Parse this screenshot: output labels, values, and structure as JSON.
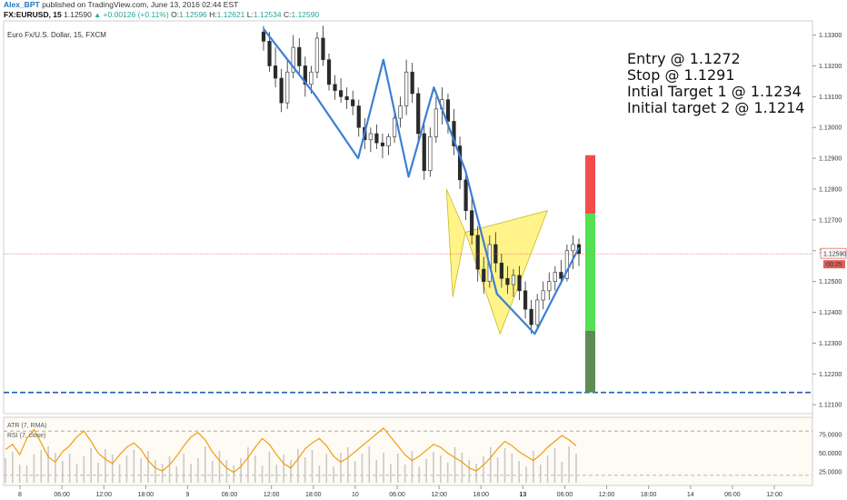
{
  "header": {
    "username": "Alex_BPT",
    "published": "published on TradingView.com, June 13, 2016 02:44 EST",
    "symbol": "FX:EURUSD, 15",
    "last": "1.12590",
    "change": "+0.00126 (+0.11%)",
    "open_label": "O:",
    "open": "1.12596",
    "high_label": "H:",
    "high": "1.12621",
    "low_label": "L:",
    "low": "1.12534",
    "close_label": "C:",
    "close": "1.12590"
  },
  "chart_data": {
    "type": "candlestick",
    "title": "Euro Fx/U.S. Dollar, 15, FXCM",
    "y_ticks": [
      "1.13300",
      "1.13200",
      "1.13100",
      "1.13000",
      "1.12900",
      "1.12800",
      "1.12700",
      "1.12600",
      "1.12500",
      "1.12400",
      "1.12300",
      "1.12200",
      "1.12100"
    ],
    "ylim": [
      1.1208,
      1.1334
    ],
    "x_ticks": [
      "8",
      "06:00",
      "12:00",
      "18:00",
      "9",
      "06:00",
      "12:00",
      "18:00",
      "10",
      "06:00",
      "12:00",
      "18:00",
      "13",
      "06:00",
      "12:00",
      "18:00",
      "14",
      "06:00",
      "12:00"
    ],
    "last_price_tag": "1.12590",
    "timer_tag": "00:25",
    "last_price": 1.1259,
    "zigzag": [
      [
        0.0,
        1.1332
      ],
      [
        0.16,
        1.1311
      ],
      [
        0.3,
        1.129
      ],
      [
        0.38,
        1.1322
      ],
      [
        0.46,
        1.1284
      ],
      [
        0.54,
        1.1313
      ],
      [
        0.64,
        1.1286
      ],
      [
        0.74,
        1.1246
      ],
      [
        0.86,
        1.1233
      ],
      [
        1.0,
        1.1261
      ]
    ],
    "abcd_lines": [
      [
        0.64,
        1.1286
      ],
      [
        0.74,
        1.1246
      ],
      [
        0.86,
        1.1233
      ],
      [
        0.96,
        1.1273
      ]
    ],
    "harmonic_pattern": {
      "X": [
        0.58,
        1.128
      ],
      "A": [
        0.6,
        1.1245
      ],
      "B": [
        0.64,
        1.1266
      ],
      "C": [
        0.75,
        1.1233
      ],
      "D": [
        0.9,
        1.1273
      ]
    },
    "candles": [
      [
        1.1331,
        1.1333,
        1.1325,
        1.1328
      ],
      [
        1.1328,
        1.1331,
        1.1318,
        1.132
      ],
      [
        1.132,
        1.1326,
        1.1313,
        1.1316
      ],
      [
        1.1316,
        1.1319,
        1.1305,
        1.1308
      ],
      [
        1.1308,
        1.1322,
        1.1306,
        1.1318
      ],
      [
        1.1318,
        1.133,
        1.1316,
        1.1326
      ],
      [
        1.1326,
        1.1329,
        1.1317,
        1.132
      ],
      [
        1.132,
        1.1323,
        1.131,
        1.1314
      ],
      [
        1.1314,
        1.132,
        1.1311,
        1.1318
      ],
      [
        1.1318,
        1.1331,
        1.1316,
        1.1329
      ],
      [
        1.1329,
        1.1333,
        1.132,
        1.1322
      ],
      [
        1.1322,
        1.1324,
        1.1312,
        1.1314
      ],
      [
        1.1314,
        1.1317,
        1.1309,
        1.1312
      ],
      [
        1.1312,
        1.1316,
        1.1308,
        1.131
      ],
      [
        1.131,
        1.1313,
        1.1306,
        1.1309
      ],
      [
        1.1309,
        1.1312,
        1.1304,
        1.1307
      ],
      [
        1.1307,
        1.1309,
        1.1297,
        1.13
      ],
      [
        1.13,
        1.1303,
        1.1293,
        1.1296
      ],
      [
        1.1296,
        1.13,
        1.1292,
        1.1298
      ],
      [
        1.1298,
        1.1301,
        1.1293,
        1.1295
      ],
      [
        1.1295,
        1.1298,
        1.129,
        1.1294
      ],
      [
        1.1294,
        1.1298,
        1.1291,
        1.1297
      ],
      [
        1.1297,
        1.1305,
        1.1295,
        1.1303
      ],
      [
        1.1303,
        1.131,
        1.13,
        1.1307
      ],
      [
        1.1307,
        1.1322,
        1.1304,
        1.1318
      ],
      [
        1.1318,
        1.1321,
        1.1308,
        1.1311
      ],
      [
        1.1311,
        1.1313,
        1.1295,
        1.1298
      ],
      [
        1.1298,
        1.1301,
        1.1283,
        1.1286
      ],
      [
        1.1286,
        1.13,
        1.1284,
        1.1297
      ],
      [
        1.1297,
        1.131,
        1.1295,
        1.1306
      ],
      [
        1.1306,
        1.1313,
        1.1301,
        1.1309
      ],
      [
        1.1309,
        1.1311,
        1.1298,
        1.1302
      ],
      [
        1.1302,
        1.1306,
        1.1291,
        1.1294
      ],
      [
        1.1294,
        1.1297,
        1.128,
        1.1283
      ],
      [
        1.1283,
        1.1285,
        1.127,
        1.1273
      ],
      [
        1.1273,
        1.1277,
        1.1262,
        1.1265
      ],
      [
        1.1265,
        1.1268,
        1.125,
        1.1254
      ],
      [
        1.1254,
        1.1258,
        1.1246,
        1.125
      ],
      [
        1.125,
        1.1265,
        1.1248,
        1.1262
      ],
      [
        1.1262,
        1.1266,
        1.1253,
        1.1256
      ],
      [
        1.1256,
        1.1259,
        1.1248,
        1.1251
      ],
      [
        1.1251,
        1.1255,
        1.1246,
        1.1249
      ],
      [
        1.1249,
        1.1254,
        1.1245,
        1.1252
      ],
      [
        1.1252,
        1.1255,
        1.1244,
        1.1247
      ],
      [
        1.1247,
        1.125,
        1.1238,
        1.1241
      ],
      [
        1.1241,
        1.1244,
        1.1233,
        1.1236
      ],
      [
        1.1236,
        1.1246,
        1.1234,
        1.1244
      ],
      [
        1.1244,
        1.125,
        1.1241,
        1.1247
      ],
      [
        1.1247,
        1.1253,
        1.1244,
        1.125
      ],
      [
        1.125,
        1.1255,
        1.1247,
        1.1253
      ],
      [
        1.1253,
        1.1257,
        1.1249,
        1.1251
      ],
      [
        1.1251,
        1.1262,
        1.125,
        1.126
      ],
      [
        1.126,
        1.1265,
        1.1254,
        1.1262
      ],
      [
        1.1262,
        1.1264,
        1.1255,
        1.1259
      ]
    ],
    "trade_levels": {
      "entry": 1.1272,
      "stop": 1.1291,
      "target1": 1.1234,
      "target2": 1.1214
    },
    "dashed_level": 1.1214,
    "annotations": [
      "Entry @ 1.1272",
      "Stop @ 1.1291",
      "Intial Target 1 @ 1.1234",
      "Initial target 2 @ 1.1214"
    ],
    "indicator": {
      "labels": [
        "ATR (7, RMA)",
        "RSI (7, close)"
      ],
      "y_ticks": [
        "75.0000",
        "50.0000",
        "25.0000"
      ],
      "ylim": [
        10,
        95
      ],
      "upper_band": 80,
      "lower_band": 20,
      "rsi": [
        55,
        62,
        48,
        70,
        82,
        64,
        45,
        38,
        52,
        60,
        72,
        80,
        66,
        50,
        42,
        36,
        48,
        58,
        64,
        55,
        40,
        30,
        26,
        34,
        46,
        60,
        72,
        78,
        68,
        52,
        40,
        30,
        24,
        32,
        44,
        58,
        70,
        62,
        48,
        36,
        30,
        42,
        56,
        64,
        70,
        60,
        46,
        38,
        44,
        52,
        60,
        68,
        76,
        84,
        72,
        60,
        48,
        40,
        46,
        54,
        62,
        58,
        50,
        44,
        38,
        30,
        26,
        34,
        44,
        56,
        66,
        60,
        52,
        46,
        40,
        48,
        58,
        66,
        74,
        68,
        60
      ]
    },
    "colors": {
      "up_candle": "#2a2a2a",
      "down_candle": "#2a2a2a",
      "zigzag": "#3d7fd3",
      "pattern_fill": "#fff176",
      "pattern_line": "#c8b92a",
      "stop_zone": "#f44c4c",
      "target_zone": "#53e053",
      "target2_zone": "#5f8c55",
      "dashed_level": "#1f5fad",
      "price_line": "#e0605a",
      "rsi_line": "#f39c12"
    }
  }
}
